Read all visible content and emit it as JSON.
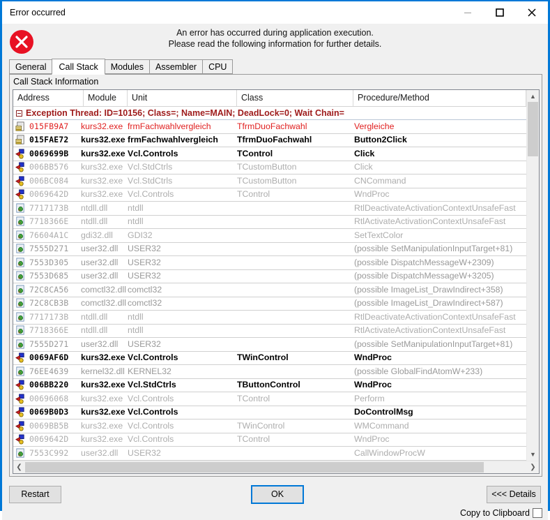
{
  "window": {
    "title": "Error occurred",
    "caption_buttons": [
      {
        "name": "minimize-button",
        "glyph": "minimize"
      },
      {
        "name": "maximize-button",
        "glyph": "maximize"
      },
      {
        "name": "close-button",
        "glyph": "close"
      }
    ],
    "accent_color": "#0078d7"
  },
  "message": {
    "icon": "error-icon",
    "line1": "An error has occurred during application execution.",
    "line2": "Please read the following information for further details."
  },
  "tabs": [
    {
      "label": "General",
      "active": false
    },
    {
      "label": "Call Stack",
      "active": true
    },
    {
      "label": "Modules",
      "active": false
    },
    {
      "label": "Assembler",
      "active": false
    },
    {
      "label": "CPU",
      "active": false
    }
  ],
  "panel": {
    "caption": "Call Stack Information"
  },
  "grid": {
    "columns": [
      "Address",
      "Module",
      "Unit",
      "Class",
      "Procedure/Method"
    ],
    "group_header": "Exception Thread: ID=10156; Class=; Name=MAIN; DeadLock=0; Wait Chain=",
    "rows": [
      {
        "icon": "source-file-icon",
        "address": "015FB9A7",
        "module": "kurs32.exe",
        "unit": "frmFachwahlvergleich",
        "cls": "TfrmDuoFachwahl",
        "proc": "Vergleiche",
        "style": "red"
      },
      {
        "icon": "source-file-icon",
        "address": "015FAE72",
        "module": "kurs32.exe",
        "unit": "frmFachwahlvergleich",
        "cls": "TfrmDuoFachwahl",
        "proc": "Button2Click",
        "style": "black"
      },
      {
        "icon": "vcl-icon",
        "address": "0069699B",
        "module": "kurs32.exe",
        "unit": "Vcl.Controls",
        "cls": "TControl",
        "proc": "Click",
        "style": "black"
      },
      {
        "icon": "vcl-icon",
        "address": "006BB576",
        "module": "kurs32.exe",
        "unit": "Vcl.StdCtrls",
        "cls": "TCustomButton",
        "proc": "Click",
        "style": "gray"
      },
      {
        "icon": "vcl-icon",
        "address": "006BC084",
        "module": "kurs32.exe",
        "unit": "Vcl.StdCtrls",
        "cls": "TCustomButton",
        "proc": "CNCommand",
        "style": "gray"
      },
      {
        "icon": "vcl-icon",
        "address": "0069642D",
        "module": "kurs32.exe",
        "unit": "Vcl.Controls",
        "cls": "TControl",
        "proc": "WndProc",
        "style": "gray"
      },
      {
        "icon": "dll-icon",
        "address": "7717173B",
        "module": "ntdll.dll",
        "unit": "ntdll",
        "cls": "",
        "proc": "RtlDeactivateActivationContextUnsafeFast",
        "style": "gray"
      },
      {
        "icon": "dll-icon",
        "address": "7718366E",
        "module": "ntdll.dll",
        "unit": "ntdll",
        "cls": "",
        "proc": "RtlActivateActivationContextUnsafeFast",
        "style": "gray"
      },
      {
        "icon": "dll-icon",
        "address": "76604A1C",
        "module": "gdi32.dll",
        "unit": "GDI32",
        "cls": "",
        "proc": "SetTextColor",
        "style": "gray"
      },
      {
        "icon": "dll-icon",
        "address": "7555D271",
        "module": "user32.dll",
        "unit": "USER32",
        "cls": "",
        "proc": "(possible SetManipulationInputTarget+81)",
        "style": "gray2"
      },
      {
        "icon": "dll-icon",
        "address": "7553D305",
        "module": "user32.dll",
        "unit": "USER32",
        "cls": "",
        "proc": "(possible DispatchMessageW+2309)",
        "style": "gray2"
      },
      {
        "icon": "dll-icon",
        "address": "7553D685",
        "module": "user32.dll",
        "unit": "USER32",
        "cls": "",
        "proc": "(possible DispatchMessageW+3205)",
        "style": "gray2"
      },
      {
        "icon": "dll-icon",
        "address": "72C8CA56",
        "module": "comctl32.dll",
        "unit": "comctl32",
        "cls": "",
        "proc": "(possible ImageList_DrawIndirect+358)",
        "style": "gray2"
      },
      {
        "icon": "dll-icon",
        "address": "72C8CB3B",
        "module": "comctl32.dll",
        "unit": "comctl32",
        "cls": "",
        "proc": "(possible ImageList_DrawIndirect+587)",
        "style": "gray2"
      },
      {
        "icon": "dll-icon",
        "address": "7717173B",
        "module": "ntdll.dll",
        "unit": "ntdll",
        "cls": "",
        "proc": "RtlDeactivateActivationContextUnsafeFast",
        "style": "gray"
      },
      {
        "icon": "dll-icon",
        "address": "7718366E",
        "module": "ntdll.dll",
        "unit": "ntdll",
        "cls": "",
        "proc": "RtlActivateActivationContextUnsafeFast",
        "style": "gray"
      },
      {
        "icon": "dll-icon",
        "address": "7555D271",
        "module": "user32.dll",
        "unit": "USER32",
        "cls": "",
        "proc": "(possible SetManipulationInputTarget+81)",
        "style": "gray2"
      },
      {
        "icon": "vcl-icon",
        "address": "0069AF6D",
        "module": "kurs32.exe",
        "unit": "Vcl.Controls",
        "cls": "TWinControl",
        "proc": "WndProc",
        "style": "black"
      },
      {
        "icon": "dll-icon",
        "address": "76EE4639",
        "module": "kernel32.dll",
        "unit": "KERNEL32",
        "cls": "",
        "proc": "(possible GlobalFindAtomW+233)",
        "style": "gray2"
      },
      {
        "icon": "vcl-icon",
        "address": "006BB220",
        "module": "kurs32.exe",
        "unit": "Vcl.StdCtrls",
        "cls": "TButtonControl",
        "proc": "WndProc",
        "style": "black"
      },
      {
        "icon": "vcl-icon",
        "address": "00696068",
        "module": "kurs32.exe",
        "unit": "Vcl.Controls",
        "cls": "TControl",
        "proc": "Perform",
        "style": "gray"
      },
      {
        "icon": "vcl-icon",
        "address": "0069B0D3",
        "module": "kurs32.exe",
        "unit": "Vcl.Controls",
        "cls": "",
        "proc": "DoControlMsg",
        "style": "black"
      },
      {
        "icon": "vcl-icon",
        "address": "0069BB5B",
        "module": "kurs32.exe",
        "unit": "Vcl.Controls",
        "cls": "TWinControl",
        "proc": "WMCommand",
        "style": "gray"
      },
      {
        "icon": "vcl-icon",
        "address": "0069642D",
        "module": "kurs32.exe",
        "unit": "Vcl.Controls",
        "cls": "TControl",
        "proc": "WndProc",
        "style": "gray"
      },
      {
        "icon": "dll-icon",
        "address": "7553C992",
        "module": "user32.dll",
        "unit": "USER32",
        "cls": "",
        "proc": "CallWindowProcW",
        "style": "gray"
      }
    ]
  },
  "footer": {
    "restart_label": "Restart",
    "ok_label": "OK",
    "details_label": "<<< Details",
    "copy_to_clipboard_label": "Copy to Clipboard",
    "copy_to_clipboard_checked": false
  }
}
